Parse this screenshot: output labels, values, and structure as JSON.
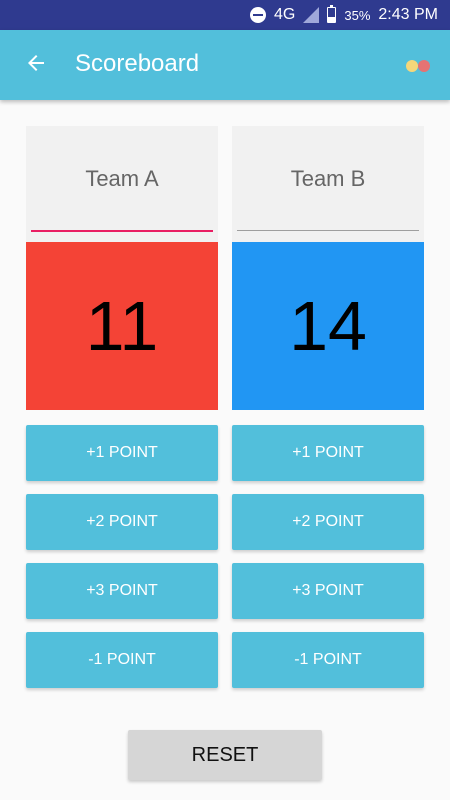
{
  "status_bar": {
    "network": "4G",
    "battery_percent": "35%",
    "battery_level": 0.35,
    "time": "2:43 PM",
    "icons": [
      "do-not-disturb-icon",
      "signal-icon",
      "battery-icon"
    ]
  },
  "app_bar": {
    "title": "Scoreboard",
    "back_icon": "arrow-left-icon",
    "brand_icon": "app-logo-icon",
    "color": "#52bfdb"
  },
  "teams": [
    {
      "name": "Team A",
      "score": "11",
      "score_color": "#f44336",
      "underline_color": "#e91e63",
      "buttons": [
        "+1 POINT",
        "+2 POINT",
        "+3 POINT",
        "-1 POINT"
      ]
    },
    {
      "name": "Team B",
      "score": "14",
      "score_color": "#2196f3",
      "underline_color": "#9e9e9e",
      "buttons": [
        "+1 POINT",
        "+2 POINT",
        "+3 POINT",
        "-1 POINT"
      ]
    }
  ],
  "reset_label": "RESET",
  "colors": {
    "button": "#52bfdb",
    "reset": "#d6d6d6",
    "status_bar": "#2f3a8f"
  }
}
